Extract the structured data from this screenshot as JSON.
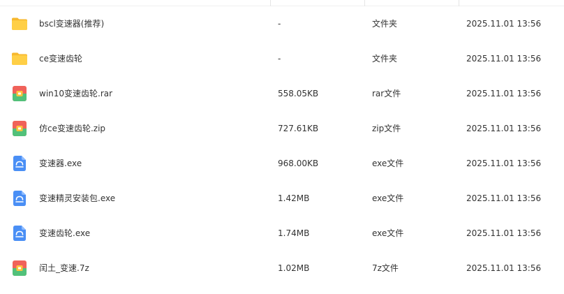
{
  "files": [
    {
      "name": "bscl变速器(推荐)",
      "size": "-",
      "type": "文件夹",
      "date": "2025.11.01 13:56",
      "icon": "folder-icon"
    },
    {
      "name": "ce变速齿轮",
      "size": "-",
      "type": "文件夹",
      "date": "2025.11.01 13:56",
      "icon": "folder-icon"
    },
    {
      "name": "win10变速齿轮.rar",
      "size": "558.05KB",
      "type": "rar文件",
      "date": "2025.11.01 13:56",
      "icon": "archive-icon"
    },
    {
      "name": "仿ce变速齿轮.zip",
      "size": "727.61KB",
      "type": "zip文件",
      "date": "2025.11.01 13:56",
      "icon": "archive-icon"
    },
    {
      "name": "变速器.exe",
      "size": "968.00KB",
      "type": "exe文件",
      "date": "2025.11.01 13:56",
      "icon": "executable-icon"
    },
    {
      "name": "变速精灵安装包.exe",
      "size": "1.42MB",
      "type": "exe文件",
      "date": "2025.11.01 13:56",
      "icon": "executable-icon"
    },
    {
      "name": "变速齿轮.exe",
      "size": "1.74MB",
      "type": "exe文件",
      "date": "2025.11.01 13:56",
      "icon": "executable-icon"
    },
    {
      "name": "闰土_变速.7z",
      "size": "1.02MB",
      "type": "7z文件",
      "date": "2025.11.01 13:56",
      "icon": "archive-icon"
    }
  ],
  "colors": {
    "folder": "#ffc93b",
    "archive_red": "#f0625a",
    "archive_green": "#52c17a",
    "archive_clasp": "#ffc43d",
    "executable": "#4a8ff5",
    "text": "#333333"
  }
}
